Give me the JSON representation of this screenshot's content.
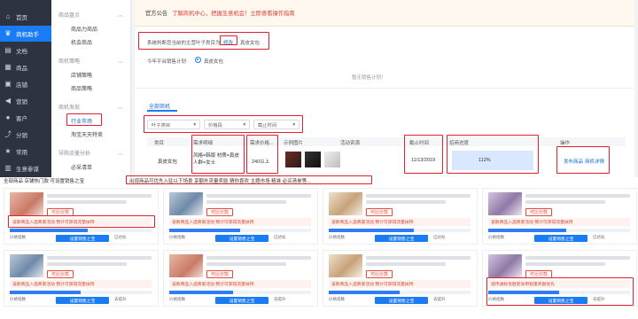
{
  "nav": {
    "items": [
      {
        "label": "首页",
        "icon": "home-icon"
      },
      {
        "label": "商机助手",
        "icon": "crown-icon",
        "active": true
      },
      {
        "label": "文档",
        "icon": "document-icon"
      },
      {
        "label": "商品",
        "icon": "grid-icon"
      },
      {
        "label": "店铺",
        "icon": "store-icon"
      },
      {
        "label": "营销",
        "icon": "megaphone-icon"
      },
      {
        "label": "客户",
        "icon": "user-icon"
      },
      {
        "label": "分销",
        "icon": "share-icon"
      },
      {
        "label": "常用",
        "icon": "star-icon"
      },
      {
        "label": "生意参谋",
        "icon": "chart-icon"
      }
    ]
  },
  "subnav": {
    "groups": [
      {
        "label": "商品盘点",
        "links": [
          "商品力商品",
          "机会商品"
        ]
      },
      {
        "label": "商机策略",
        "links": [
          "店铺策略",
          "商品策略"
        ]
      },
      {
        "label": "商机发现",
        "links": [
          "行业市场",
          "淘宝天天特卖"
        ]
      },
      {
        "label": "导购流量分析",
        "links": [
          "必采清单"
        ]
      }
    ],
    "selected": "行业市场"
  },
  "notice": {
    "tag": "官方公告",
    "message": "了解商机中心，把握生意机会！立即查看操作指南"
  },
  "category": {
    "prefix": "系统判断您当前的主营叶子类目为",
    "edit": "修改",
    "value": "真皮女包"
  },
  "trend": {
    "label": "今年平台销售计划",
    "radio": "真皮女包"
  },
  "empty_text": "暂无销售计划！",
  "tabs": {
    "active": "全部商机"
  },
  "filters": [
    "叶子类目",
    "价格段",
    "截止时间"
  ],
  "table": {
    "headers": [
      "类目",
      "需求明细",
      "需求价格...",
      "示例图片",
      "活动资源",
      "截止时间",
      "招商进度",
      "操作"
    ],
    "rows": [
      {
        "category": "真皮女包",
        "detail": "风格=韩版 材质=真皮 人群=女士",
        "price": "240以上",
        "deadline": "11/13/2019",
        "progress": "112%",
        "progress_fill": 1.0,
        "actions": [
          "发布商品",
          "商机详情"
        ]
      }
    ]
  },
  "bottom": {
    "title": "全部商品 店铺热门款 可设置销售之宝",
    "banner": "出现商品可优先入驻以下场景 享额外流量奖励 猜你喜欢 主题市场 精准 必买清单等...",
    "cards": [
      {
        "badge": "可比价款",
        "note": "该款商品入选商家活动 预计可获得流量扶持",
        "hint": "提升中达标同行量首屈",
        "btn": "设置销售之宝",
        "thumb": "a",
        "fill": 0.55,
        "stats": [
          "价格指数",
          "低于平均",
          "已达标"
        ]
      },
      {
        "badge": "可比价款",
        "note": "该款商品入选商家活动 预计可获得流量扶持",
        "hint": "提升中达标同行量首屈",
        "btn": "设置销售之宝",
        "thumb": "b",
        "fill": 0.5,
        "stats": [
          "价格指数",
          "低于平均",
          "已达标"
        ]
      },
      {
        "badge": "可比价款",
        "note": "该款商品入选商家活动 预计可获得流量扶持",
        "hint": "提升中达标同行量首屈",
        "btn": "设置销售之宝",
        "thumb": "c",
        "fill": 0.6,
        "stats": [
          "价格指数",
          "低于平均",
          "已达标"
        ]
      },
      {
        "badge": "可比价款",
        "note": "该款商品入选商家活动 预计可获得流量扶持",
        "hint": "提升中达标同行量首屈",
        "btn": "设置销售之宝",
        "thumb": "d",
        "fill": 0.55,
        "stats": [
          "价格指数",
          "低于平均",
          "已达标"
        ]
      },
      {
        "badge": "可比价款",
        "note": "该款商品入选商家活动 预计可获得流量扶持",
        "hint": "提升中达标同行量首屈",
        "btn": "设置销售之宝",
        "thumb": "b",
        "fill": 0.5,
        "stats": [
          "价格指数",
          "低于平均",
          "去提升"
        ]
      },
      {
        "badge": "可比价款",
        "note": "该款商品入选商家活动 预计可获得流量扶持",
        "hint": "提升中达标同行量首屈",
        "btn": "设置销售之宝",
        "thumb": "a",
        "fill": 0.45,
        "stats": [
          "价格指数",
          "低于平均",
          "去提升"
        ]
      },
      {
        "badge": "可比价款",
        "note": "该款商品入选商家活动 预计可获得流量扶持",
        "hint": "提升中达标同行量首屈",
        "btn": "设置销售之宝",
        "thumb": "c",
        "fill": 0.5,
        "stats": [
          "价格指数",
          "低于平均",
          "去提升"
        ]
      },
      {
        "badge": "可比价款",
        "note": "适传通标优胜套采用销量奖励优先",
        "hint": "提升中达标同行量首屈",
        "btn": "设置销售之宝",
        "thumb": "d",
        "fill": 0.5,
        "stats": [
          "价格指数",
          "低于平均",
          "去提升"
        ]
      }
    ]
  }
}
